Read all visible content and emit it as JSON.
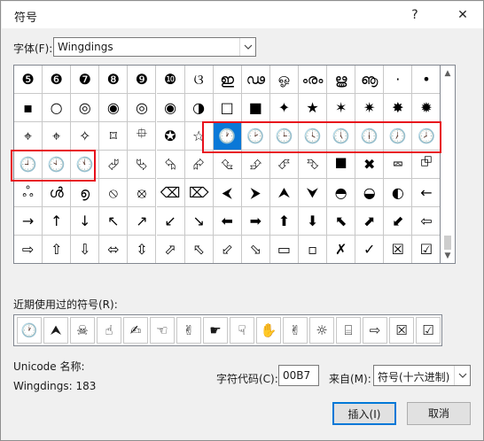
{
  "window": {
    "title": "符号",
    "help": "?",
    "close": "✕"
  },
  "font": {
    "label": "字体(F):",
    "value": "Wingdings"
  },
  "grid": {
    "rows": [
      [
        "❺",
        "❻",
        "❼",
        "❽",
        "❾",
        "❿",
        "ଓ",
        "ഇ",
        "ഢ",
        "ஓ",
        "ൟ",
        "ൠ",
        "ൡ",
        "·",
        "•"
      ],
      [
        "▪",
        "○",
        "◎",
        "◉",
        "◎",
        "◉",
        "◑",
        "□",
        "■",
        "✦",
        "★",
        "✶",
        "✷",
        "✸",
        "✹"
      ],
      [
        "⌖",
        "⌖",
        "✧",
        "⌑",
        "⯐",
        "✪",
        "☆",
        "🕐",
        "🕑",
        "🕒",
        "🕓",
        "🕔",
        "🕕",
        "🕖",
        "🕗"
      ],
      [
        "🕘",
        "🕙",
        "🕚",
        "⮰",
        "⮱",
        "⮲",
        "⮳",
        "⮴",
        "⮵",
        "⮶",
        "⮷",
        "⯀",
        "✖",
        "⮹",
        "⮺"
      ],
      [
        "ஃ",
        "ൾ",
        "൭",
        "⦸",
        "⦻",
        "⌫",
        "⌦",
        "⮜",
        "⮞",
        "⮝",
        "⮟",
        "◓",
        "◒",
        "◐",
        "←"
      ],
      [
        "→",
        "↑",
        "↓",
        "↖",
        "↗",
        "↙",
        "↘",
        "⬅",
        "➡",
        "⬆",
        "⬇",
        "⬉",
        "⬈",
        "⬋",
        "⇦"
      ],
      [
        "⇨",
        "⇧",
        "⇩",
        "⬄",
        "⇳",
        "⬀",
        "⬁",
        "⬃",
        "⬂",
        "▭",
        "▫",
        "✗",
        "✓",
        "☒",
        "☑"
      ]
    ],
    "selected_symbol": "🕐"
  },
  "recent": {
    "label": "近期使用过的符号(R):",
    "symbols": [
      "🕐",
      "⮝",
      "☠",
      "☝",
      "✍",
      "☜",
      "✌",
      "☛",
      "☟",
      "✋",
      "✌",
      "☼",
      "⌸",
      "⇨",
      "☒",
      "☑"
    ]
  },
  "unicode_name": {
    "label": "Unicode 名称:",
    "value": "Wingdings: 183"
  },
  "char_code": {
    "label": "字符代码(C):",
    "value": "00B7"
  },
  "from": {
    "label": "来自(M):",
    "value": "符号(十六进制)"
  },
  "buttons": {
    "insert": "插入(I)",
    "cancel": "取消"
  }
}
